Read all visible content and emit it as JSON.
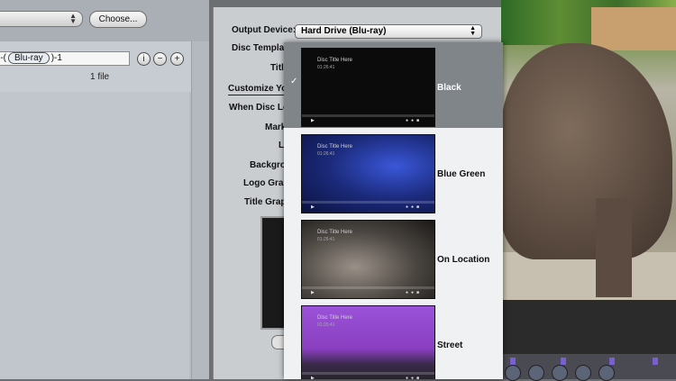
{
  "left_panel": {
    "choose_label": "Choose...",
    "name_token": "Blu-ray",
    "name_prefix": ")-(",
    "name_suffix": ")-1",
    "file_count": "1 file",
    "info_symbol": "i",
    "minus_symbol": "−",
    "plus_symbol": "+"
  },
  "settings": {
    "output_device_label": "Output Device:",
    "output_device_value": "Hard Drive (Blu-ray)",
    "disc_template_label": "Disc Template",
    "title_label": "Title",
    "customize_label": "Customize Yo",
    "when_disc_label": "When Disc Lo",
    "mark_label": "Mark",
    "lo_label": "Lo",
    "background_label": "Backgrou",
    "logo_graphic_label": "Logo Grap",
    "title_graphic_label": "Title Grap"
  },
  "template_menu": {
    "items": [
      {
        "label": "Black",
        "thumb_title": "Disc Title Here",
        "thumb_time": "01:26:41",
        "selected": true
      },
      {
        "label": "Blue Green",
        "thumb_title": "Disc Title Here",
        "thumb_time": "01:26:41",
        "selected": false
      },
      {
        "label": "On Location",
        "thumb_title": "Disc Title Here",
        "thumb_time": "01:26:41",
        "selected": false
      },
      {
        "label": "Street",
        "thumb_title": "Disc Title Here",
        "thumb_time": "01:26:41",
        "selected": false
      }
    ],
    "check_glyph": "✓"
  },
  "colors": {
    "selection": "#7f8589",
    "black_theme": "#0b0b0c",
    "blue_green_theme": "#1b2a7a",
    "on_location_theme": "#4a4540",
    "street_theme": "#8a3fc0"
  }
}
